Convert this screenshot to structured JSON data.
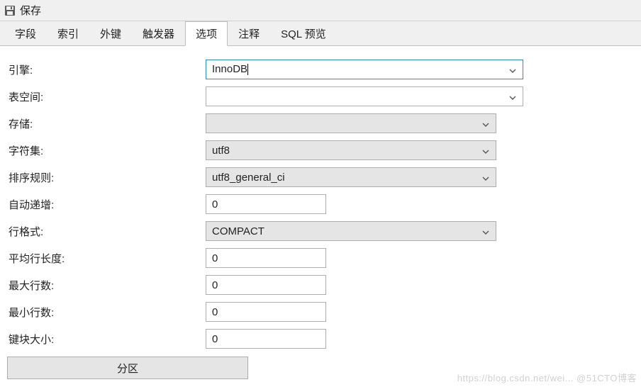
{
  "window": {
    "title": "保存",
    "icon": "save-icon"
  },
  "tabs": {
    "items": [
      {
        "label": "字段"
      },
      {
        "label": "索引"
      },
      {
        "label": "外键"
      },
      {
        "label": "触发器"
      },
      {
        "label": "选项",
        "active": true
      },
      {
        "label": "注释"
      },
      {
        "label": "SQL 预览"
      }
    ]
  },
  "form": {
    "engine": {
      "label": "引擎:",
      "value": "InnoDB"
    },
    "tablespace": {
      "label": "表空间:",
      "value": ""
    },
    "storage": {
      "label": "存储:",
      "value": ""
    },
    "charset": {
      "label": "字符集:",
      "value": "utf8"
    },
    "collation": {
      "label": "排序规则:",
      "value": "utf8_general_ci"
    },
    "autoinc": {
      "label": "自动递增:",
      "value": "0"
    },
    "rowformat": {
      "label": "行格式:",
      "value": "COMPACT"
    },
    "avgrowlen": {
      "label": "平均行长度:",
      "value": "0"
    },
    "maxrows": {
      "label": "最大行数:",
      "value": "0"
    },
    "minrows": {
      "label": "最小行数:",
      "value": "0"
    },
    "keyblock": {
      "label": "键块大小:",
      "value": "0"
    }
  },
  "partition_button": "分区",
  "watermark": "https://blog.csdn.net/wei... @51CTO博客"
}
